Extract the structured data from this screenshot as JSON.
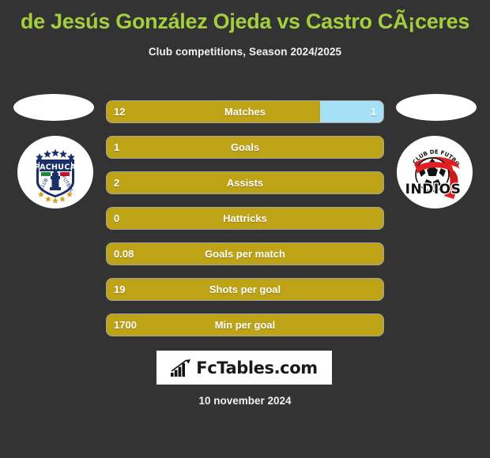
{
  "header": {
    "title": "de Jesús González Ojeda vs Castro CÃ¡ceres",
    "subtitle": "Club competitions, Season 2024/2025",
    "title_color": "#a5ce3f"
  },
  "theme": {
    "background": "#333333",
    "bar_home_color": "#bda315",
    "bar_away_color": "#a7e1f7",
    "text_color": "#ffffff"
  },
  "home": {
    "club_name": "PACHUCA",
    "club_motto_left": "CLUB DE",
    "club_motto_right": "FUTBOL",
    "badge_icon": "pachuca-club-badge",
    "photo_icon": "player-photo-placeholder"
  },
  "away": {
    "club_name": "INDIOS",
    "club_motto": "CLUB DE FUTBOL",
    "badge_icon": "indios-club-badge",
    "photo_icon": "player-photo-placeholder"
  },
  "stats": [
    {
      "label": "Matches",
      "home": "12",
      "away": "1",
      "home_pct": 77,
      "away_pct": 23,
      "split": true
    },
    {
      "label": "Goals",
      "home": "1",
      "away": "",
      "home_pct": 100,
      "away_pct": 0,
      "split": false
    },
    {
      "label": "Assists",
      "home": "2",
      "away": "",
      "home_pct": 100,
      "away_pct": 0,
      "split": false
    },
    {
      "label": "Hattricks",
      "home": "0",
      "away": "",
      "home_pct": 100,
      "away_pct": 0,
      "split": false
    },
    {
      "label": "Goals per match",
      "home": "0.08",
      "away": "",
      "home_pct": 100,
      "away_pct": 0,
      "split": false
    },
    {
      "label": "Shots per goal",
      "home": "19",
      "away": "",
      "home_pct": 100,
      "away_pct": 0,
      "split": false
    },
    {
      "label": "Min per goal",
      "home": "1700",
      "away": "",
      "home_pct": 100,
      "away_pct": 0,
      "split": false
    }
  ],
  "footer": {
    "brand_text": "FcTables.com",
    "brand_icon": "bar-chart-growth-icon",
    "date": "10 november 2024"
  }
}
